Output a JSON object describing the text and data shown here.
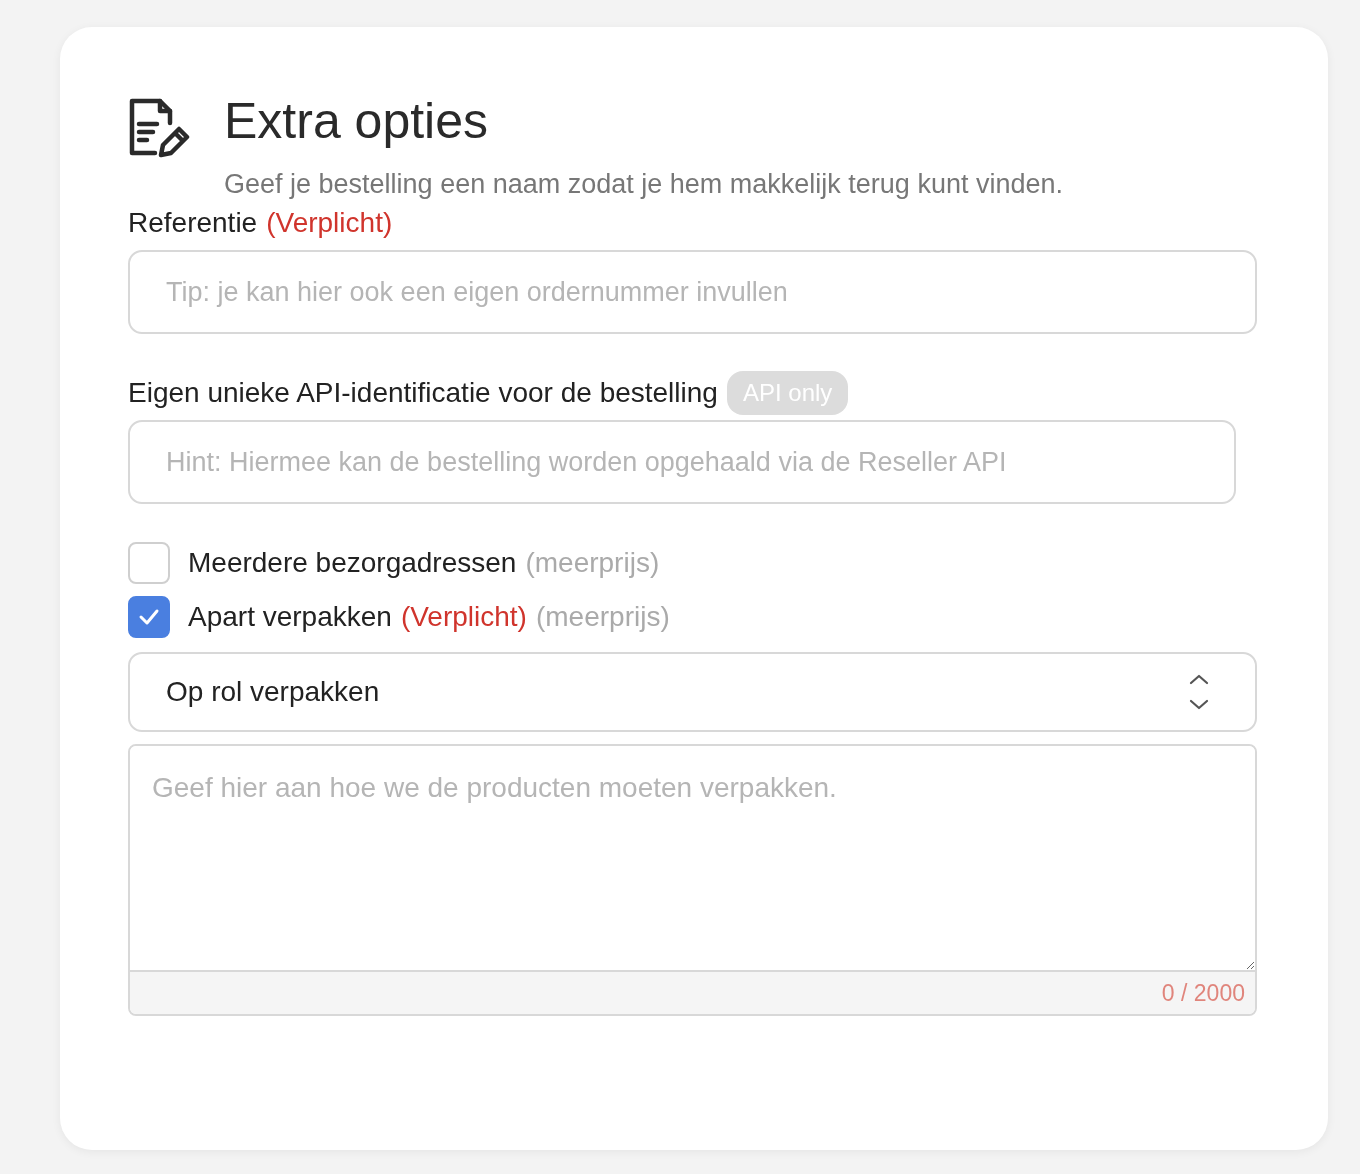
{
  "header": {
    "title": "Extra opties",
    "subtitle": "Geef je bestelling een naam zodat je hem makkelijk terug kunt vinden."
  },
  "fields": [
    {
      "kind": "text",
      "label": "Referentie",
      "required_note": "(Verplicht)",
      "placeholder": "Tip: je kan hier ook een eigen ordernummer invullen",
      "wide": true
    },
    {
      "kind": "text",
      "label": "Eigen unieke API-identificatie voor de bestelling",
      "badge": "API only",
      "placeholder": "Hint: Hiermee kan de bestelling worden opgehaald via de Reseller API",
      "wide": false
    }
  ],
  "options": [
    {
      "label": "Meerdere bezorgadressen",
      "extra": "(meerprijs)",
      "checked": false
    },
    {
      "label": "Apart verpakken",
      "required_note": "(Verplicht)",
      "extra": "(meerprijs)",
      "checked": true
    }
  ],
  "select": {
    "value": "Op rol verpakken"
  },
  "textarea": {
    "placeholder": "Geef hier aan hoe we de producten moeten verpakken.",
    "counter": "0 / 2000"
  }
}
